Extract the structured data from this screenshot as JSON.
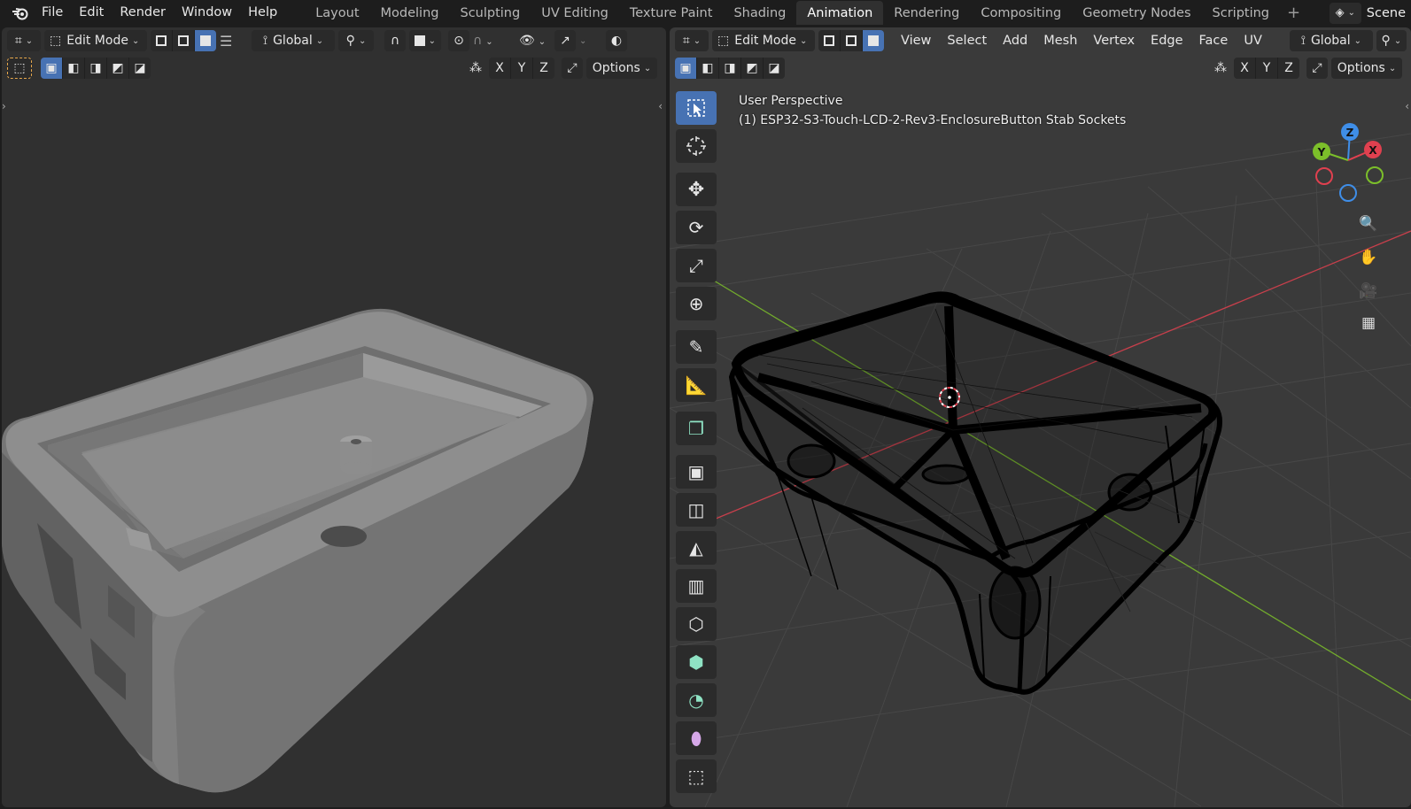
{
  "menu": {
    "items": [
      "File",
      "Edit",
      "Render",
      "Window",
      "Help"
    ]
  },
  "workspaces": {
    "tabs": [
      "Layout",
      "Modeling",
      "Sculpting",
      "UV Editing",
      "Texture Paint",
      "Shading",
      "Animation",
      "Rendering",
      "Compositing",
      "Geometry Nodes",
      "Scripting"
    ],
    "active": "Animation"
  },
  "scene": {
    "label": "Scene"
  },
  "left_editor": {
    "mode": "Edit Mode",
    "orientation": "Global",
    "axes": [
      "X",
      "Y",
      "Z"
    ],
    "options_label": "Options"
  },
  "right_editor": {
    "mode": "Edit Mode",
    "menus": [
      "View",
      "Select",
      "Add",
      "Mesh",
      "Vertex",
      "Edge",
      "Face",
      "UV"
    ],
    "orientation": "Global",
    "axes": [
      "X",
      "Y",
      "Z"
    ],
    "options_label": "Options",
    "view_name": "User Perspective",
    "object_name": "(1) ESP32-S3-Touch-LCD-2-Rev3-EnclosureButton Stab Sockets",
    "gizmo_axes": {
      "x": "X",
      "y": "Y",
      "z": "Z"
    }
  },
  "icons": {
    "toolbar": [
      "select-box-icon",
      "cursor-icon",
      "move-icon",
      "rotate-icon",
      "scale-icon",
      "transform-icon",
      "annotate-icon",
      "measure-icon",
      "add-cube-icon",
      "extrude-region-icon",
      "inset-faces-icon",
      "bevel-icon",
      "loop-cut-icon",
      "knife-icon",
      "poly-build-icon",
      "spin-icon",
      "smooth-icon",
      "edge-slide-icon"
    ]
  },
  "colors": {
    "accent": "#4772b3",
    "axis_x": "#e0404f",
    "axis_y": "#7cbf2a",
    "axis_z": "#3f8ee8"
  }
}
